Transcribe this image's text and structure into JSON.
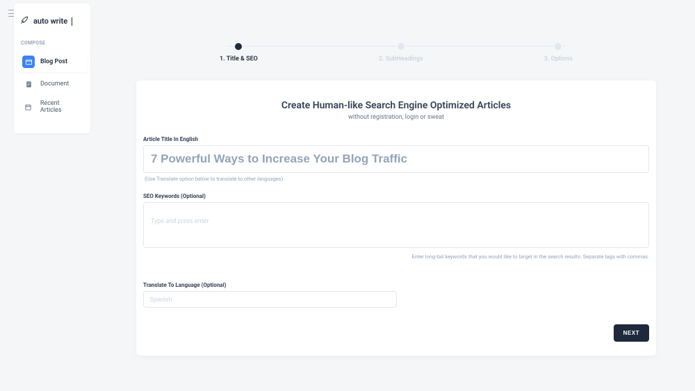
{
  "brand": {
    "name": "auto write"
  },
  "sidebar": {
    "section": "COMPOSE",
    "items": [
      {
        "label": "Blog Post"
      },
      {
        "label": "Document"
      },
      {
        "label": "Recent Articles"
      }
    ]
  },
  "stepper": {
    "steps": [
      {
        "label": "1. Title & SEO"
      },
      {
        "label": "2. SubHeadings"
      },
      {
        "label": "3. Options"
      }
    ]
  },
  "card": {
    "title": "Create Human-like Search Engine Optimized Articles",
    "subtitle": "without registration, login or sweat",
    "title_label": "Article Title In English",
    "title_placeholder": "7 Powerful Ways to Increase Your Blog Traffic",
    "title_hint": "(Use Translate option below to translate to other languages)",
    "seo_label": "SEO Keywords (Optional)",
    "seo_placeholder": "Type and press enter",
    "seo_hint": "Enter long-tail keywords that you would like to target in the search results. Separate tags with commas.",
    "lang_label": "Translate To Language (Optional)",
    "lang_placeholder": "Spanish",
    "next": "NEXT"
  }
}
